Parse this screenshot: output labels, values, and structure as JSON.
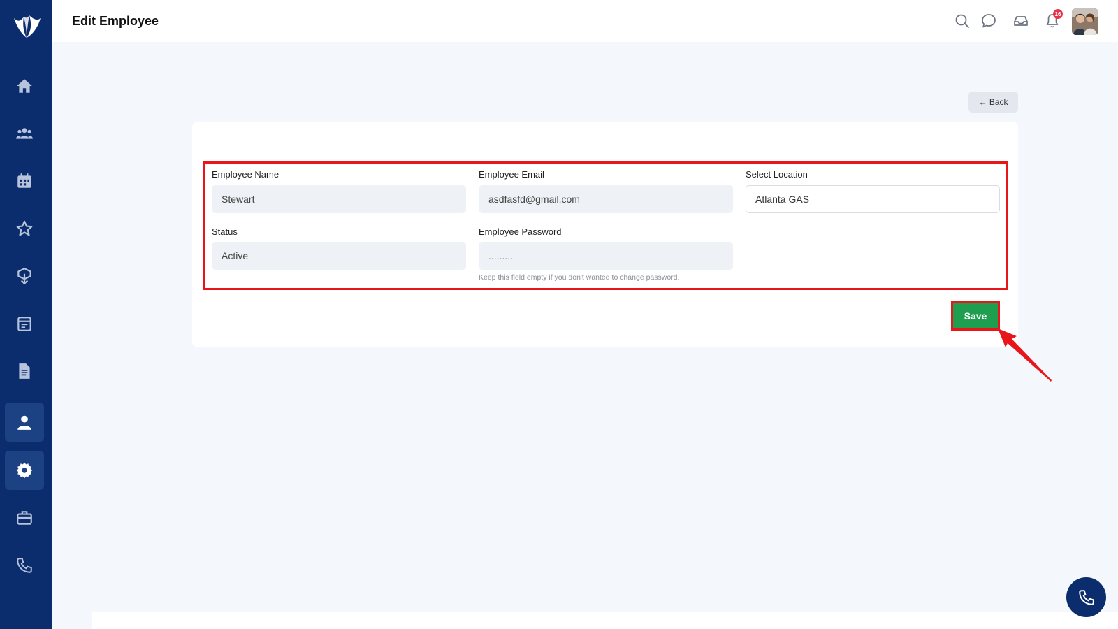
{
  "header": {
    "title": "Edit Employee",
    "notification_count": "16"
  },
  "actions": {
    "back_label": "← Back",
    "save_label": "Save"
  },
  "form": {
    "employee_name": {
      "label": "Employee Name",
      "value": "Stewart"
    },
    "employee_email": {
      "label": "Employee Email",
      "value": "asdfasfd@gmail.com"
    },
    "select_location": {
      "label": "Select Location",
      "value": "Atlanta GAS"
    },
    "status": {
      "label": "Status",
      "value": "Active"
    },
    "employee_password": {
      "label": "Employee Password",
      "value": ".........",
      "hint": "Keep this field empty if you don't wanted to change password."
    }
  },
  "sidebar": {
    "items": [
      {
        "icon": "home-icon"
      },
      {
        "icon": "users-icon"
      },
      {
        "icon": "calendar-icon"
      },
      {
        "icon": "star-icon"
      },
      {
        "icon": "cube-icon"
      },
      {
        "icon": "schedule-icon"
      },
      {
        "icon": "document-icon"
      },
      {
        "icon": "user-icon",
        "active": true
      },
      {
        "icon": "gear-icon",
        "active": true
      },
      {
        "icon": "briefcase-icon"
      },
      {
        "icon": "phone-icon"
      }
    ]
  },
  "colors": {
    "sidebar": "#0b2d6e",
    "accent_save": "#1e9e4f",
    "annotation": "#e8151b",
    "badge": "#e8344a"
  }
}
